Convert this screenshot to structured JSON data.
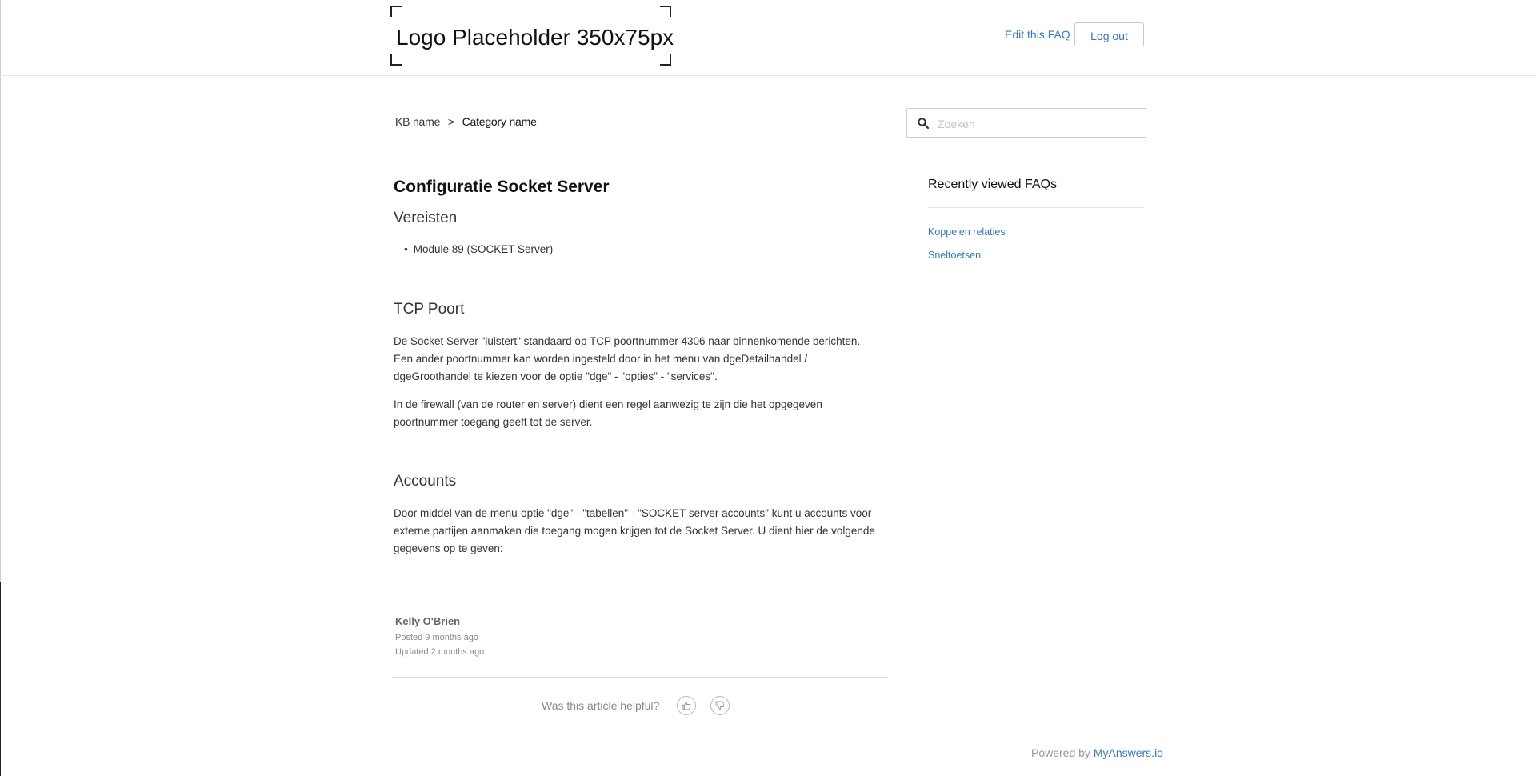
{
  "header": {
    "logo_text": "Logo Placeholder 350x75px",
    "edit_link": "Edit this FAQ",
    "logout_label": "Log out"
  },
  "breadcrumb": {
    "root": "KB name",
    "separator": ">",
    "current": "Category name"
  },
  "search": {
    "placeholder": "Zoeken",
    "icon": "search-icon"
  },
  "article": {
    "title": "Configuratie Socket Server",
    "sections": [
      {
        "heading": "Vereisten",
        "list": [
          "Module 89 (SOCKET Server)"
        ]
      },
      {
        "heading": "TCP Poort",
        "paragraphs": [
          "De Socket Server \"luistert\" standaard op TCP poortnummer 4306 naar binnenkomende berichten. Een ander poortnummer kan worden ingesteld door in het menu van dgeDetailhandel / dgeGroothandel te kiezen voor de optie \"dge\" - \"opties\" - \"services\".",
          "In de firewall (van de router en server) dient een regel aanwezig te zijn die het opgegeven poortnummer toegang geeft tot de server."
        ]
      },
      {
        "heading": "Accounts",
        "paragraphs": [
          "Door middel van de menu-optie \"dge\" - \"tabellen\" - \"SOCKET server accounts\" kunt u accounts voor externe partijen aanmaken die toegang mogen krijgen tot de Socket Server. U dient hier de volgende gegevens op te geven:"
        ]
      }
    ],
    "author": "Kelly O'Brien",
    "posted": "Posted 9 months ago",
    "updated": "Updated 2 months ago",
    "helpful_question": "Was this article helpful?",
    "vote_icons": [
      "thumbs-up-icon",
      "thumbs-down-icon"
    ]
  },
  "sidebar": {
    "title": "Recently viewed FAQs",
    "links": [
      "Koppelen relaties",
      "Sneltoetsen"
    ]
  },
  "footer": {
    "powered_prefix": "Powered by",
    "powered_brand": "MyAnswers.io"
  },
  "colors": {
    "link": "#3a78b8",
    "text": "#333333",
    "muted": "#888888"
  }
}
